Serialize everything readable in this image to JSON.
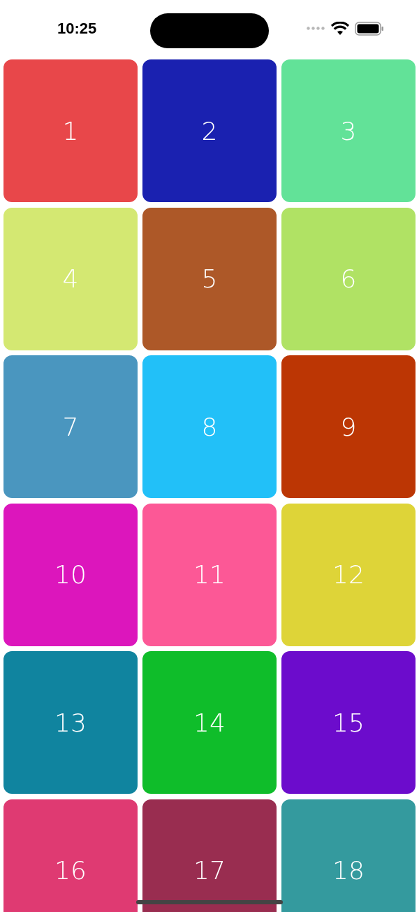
{
  "status_bar": {
    "time": "10:25"
  },
  "tiles": [
    {
      "label": "1",
      "color": "#e8474a"
    },
    {
      "label": "2",
      "color": "#1a21b0"
    },
    {
      "label": "3",
      "color": "#62e298"
    },
    {
      "label": "4",
      "color": "#d4e872"
    },
    {
      "label": "5",
      "color": "#ad5828"
    },
    {
      "label": "6",
      "color": "#b0e264"
    },
    {
      "label": "7",
      "color": "#4a96bf"
    },
    {
      "label": "8",
      "color": "#22c0f8"
    },
    {
      "label": "9",
      "color": "#bc3604"
    },
    {
      "label": "10",
      "color": "#dc16bc"
    },
    {
      "label": "11",
      "color": "#fc5896"
    },
    {
      "label": "12",
      "color": "#ded438"
    },
    {
      "label": "13",
      "color": "#10849f"
    },
    {
      "label": "14",
      "color": "#0fbd2a"
    },
    {
      "label": "15",
      "color": "#6c0ccc"
    },
    {
      "label": "16",
      "color": "#df3a72"
    },
    {
      "label": "17",
      "color": "#992d50"
    },
    {
      "label": "18",
      "color": "#349a9e"
    }
  ]
}
